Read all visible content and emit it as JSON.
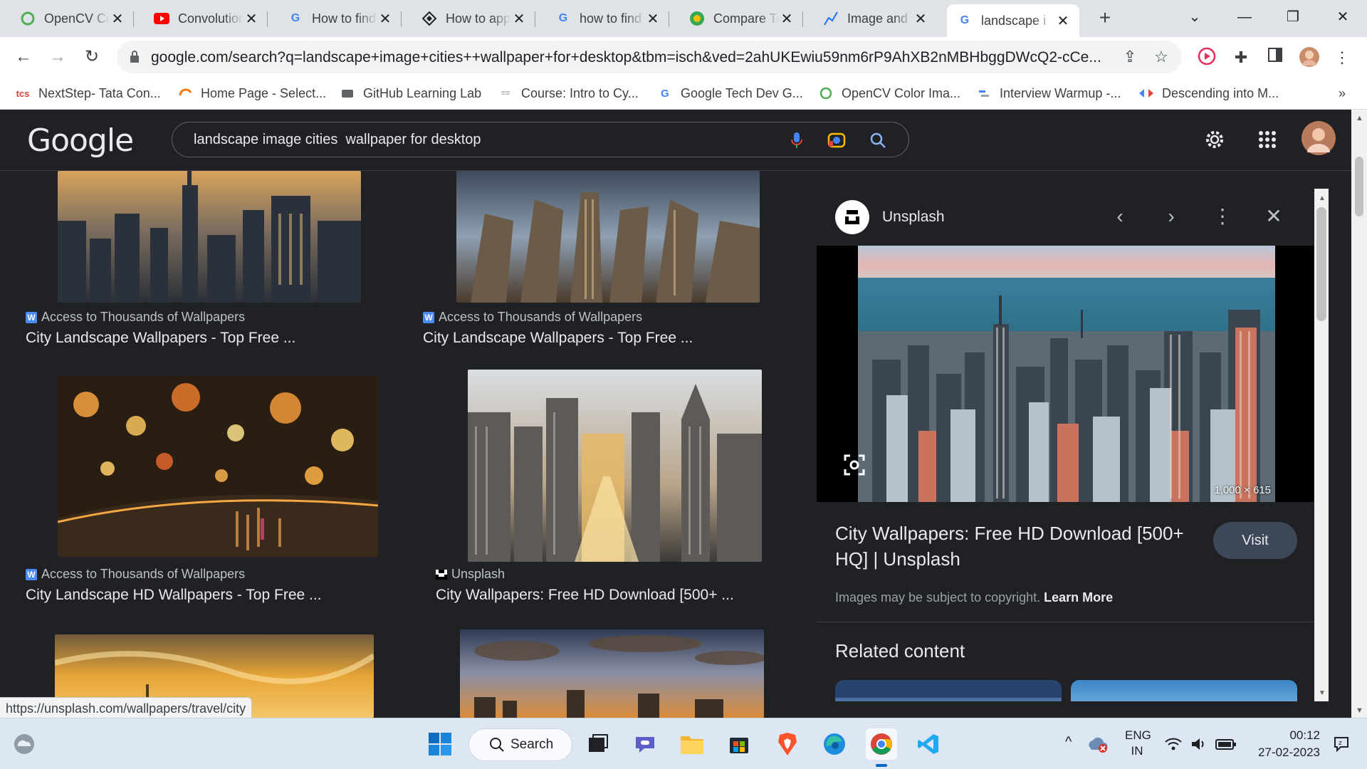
{
  "tabs": [
    {
      "title": "OpenCV Co",
      "icon": "opencv-icon",
      "active": false
    },
    {
      "title": "Convolution",
      "icon": "youtube-icon",
      "active": false
    },
    {
      "title": "How to find",
      "icon": "google-icon",
      "active": false
    },
    {
      "title": "How to app",
      "icon": "diamond-icon",
      "active": false
    },
    {
      "title": "how to find",
      "icon": "google-icon",
      "active": false
    },
    {
      "title": "Compare Te",
      "icon": "compare-icon",
      "active": false
    },
    {
      "title": "Image and",
      "icon": "chart-icon",
      "active": false
    },
    {
      "title": "landscape i",
      "icon": "google-icon",
      "active": true
    }
  ],
  "url": "google.com/search?q=landscape+image+cities++wallpaper+for+desktop&tbm=isch&ved=2ahUKEwiu59nm6rP9AhXB2nMBHbggDWcQ2-cCe...",
  "bookmarks": [
    {
      "label": "NextStep- Tata Con...",
      "icon": "tcs-icon"
    },
    {
      "label": "Home Page - Select...",
      "icon": "orange-arc-icon"
    },
    {
      "label": "GitHub Learning Lab",
      "icon": "github-icon"
    },
    {
      "label": "Course: Intro to Cy...",
      "icon": "course-icon"
    },
    {
      "label": "Google Tech Dev G...",
      "icon": "google-icon"
    },
    {
      "label": "OpenCV Color Ima...",
      "icon": "opencv-icon"
    },
    {
      "label": "Interview Warmup -...",
      "icon": "warmup-icon"
    },
    {
      "label": "Descending into M...",
      "icon": "ml-icon"
    }
  ],
  "google": {
    "logo": "Google",
    "query": "landscape image cities  wallpaper for desktop"
  },
  "results": [
    {
      "source": "Access to Thousands of Wallpapers",
      "title": "City Landscape Wallpapers - Top Free ..."
    },
    {
      "source": "Access to Thousands of Wallpapers",
      "title": "City Landscape Wallpapers - Top Free ..."
    },
    {
      "source": "Access to Thousands of Wallpapers",
      "title": "City Landscape HD Wallpapers - Top Free ..."
    },
    {
      "source": "Unsplash",
      "title": "City Wallpapers: Free HD Download [500+ ..."
    }
  ],
  "panel": {
    "site": "Unsplash",
    "dimensions": "1,000 × 615",
    "title": "City Wallpapers: Free HD Download [500+ HQ] | Unsplash",
    "visit": "Visit",
    "copyright": "Images may be subject to copyright.",
    "learn_more": "Learn More",
    "related": "Related content"
  },
  "status_url": "https://unsplash.com/wallpapers/travel/city",
  "taskbar": {
    "search": "Search",
    "lang1": "ENG",
    "lang2": "IN",
    "time": "00:12",
    "date": "27-02-2023"
  },
  "colors": {
    "page_bg": "#202124",
    "accent_blue": "#8ab4f8",
    "visit_bg": "#3c4757"
  }
}
